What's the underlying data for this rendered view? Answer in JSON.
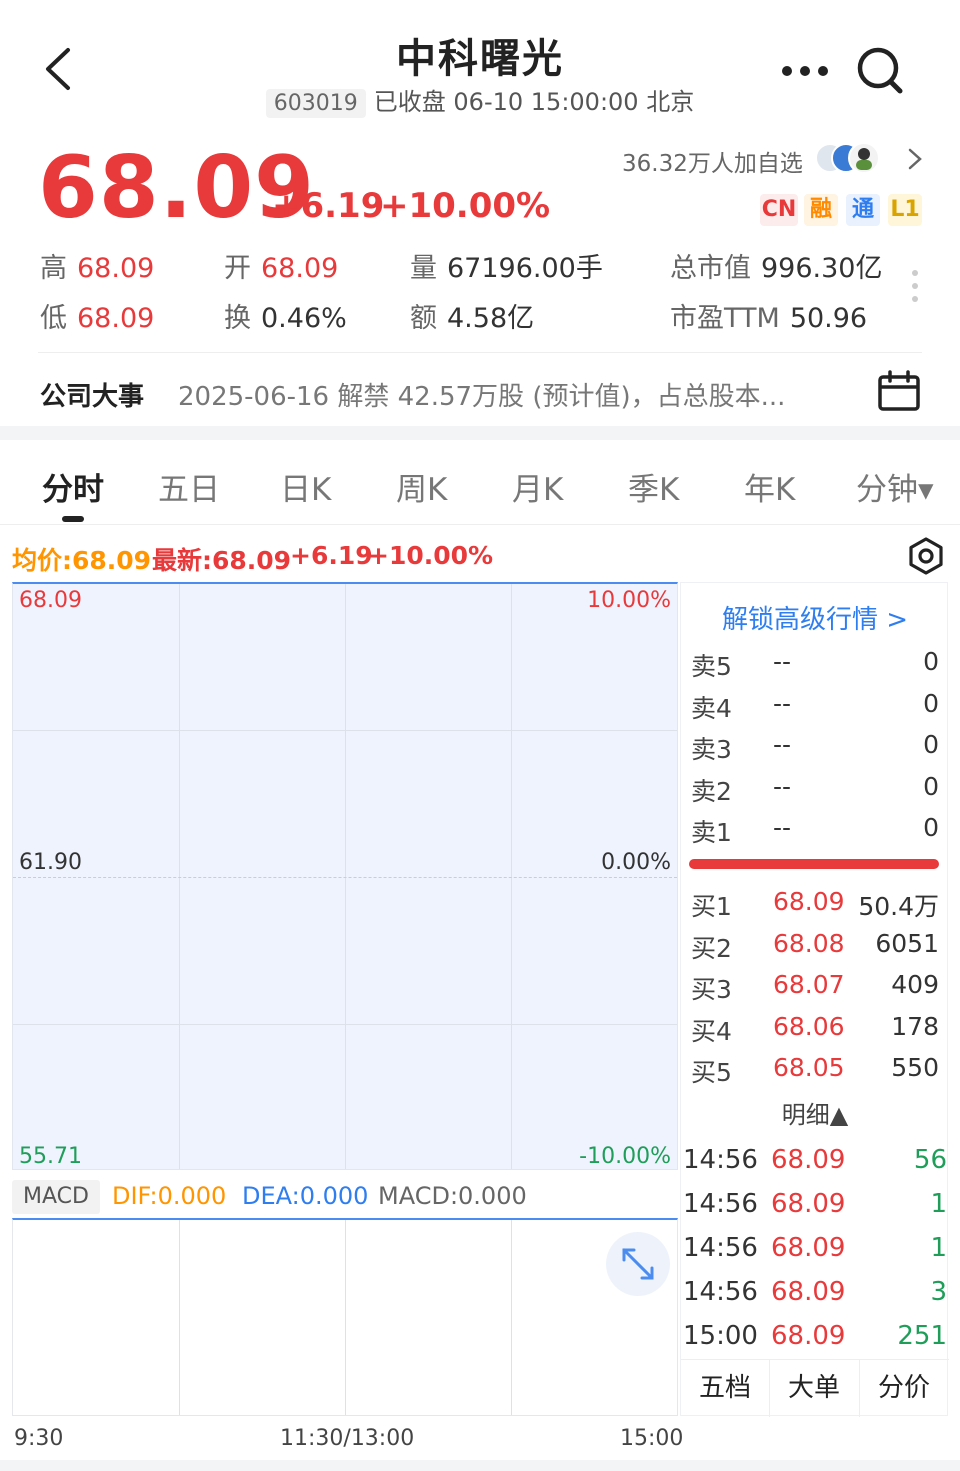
{
  "header": {
    "title": "中科曙光",
    "code": "603019",
    "status": "已收盘 06-10 15:00:00 北京",
    "back_icon": "back-arrow-icon",
    "more_icon": "more-dots-icon",
    "search_icon": "search-icon"
  },
  "quote": {
    "price": "68.09",
    "change": "+6.19",
    "change_pct": "+10.00%",
    "followers": "36.32万人加自选",
    "tags": [
      "CN",
      "融",
      "通",
      "L1"
    ]
  },
  "stats": {
    "high_k": "高",
    "high_v": "68.09",
    "open_k": "开",
    "open_v": "68.09",
    "vol_k": "量",
    "vol_v": "67196.00手",
    "mcap_k": "总市值",
    "mcap_v": "996.30亿",
    "low_k": "低",
    "low_v": "68.09",
    "turn_k": "换",
    "turn_v": "0.46%",
    "amt_k": "额",
    "amt_v": "4.58亿",
    "pe_k": "市盈TTM",
    "pe_v": "50.96"
  },
  "event": {
    "label": "公司大事",
    "text": "2025-06-16 解禁 42.57万股 (预计值)，占总股本..."
  },
  "tabs": [
    "分时",
    "五日",
    "日K",
    "周K",
    "月K",
    "季K",
    "年K",
    "分钟▾"
  ],
  "chart_header": {
    "avg": "均价:68.09",
    "latest": "最新:68.09",
    "change": "+6.19",
    "change_pct": "+10.00%"
  },
  "chart": {
    "y_top": "68.09",
    "y_mid": "61.90",
    "y_bot": "55.71",
    "pct_top": "10.00%",
    "pct_mid": "0.00%",
    "pct_bot": "-10.00%",
    "x_labels": [
      "9:30",
      "11:30/13:00",
      "15:00"
    ]
  },
  "macd": {
    "label": "MACD",
    "dif": "DIF:0.000",
    "dea": "DEA:0.000",
    "macd": "MACD:0.000"
  },
  "orderbook": {
    "unlock": "解锁高级行情 >",
    "asks": [
      {
        "label": "卖5",
        "price": "--",
        "vol": "0"
      },
      {
        "label": "卖4",
        "price": "--",
        "vol": "0"
      },
      {
        "label": "卖3",
        "price": "--",
        "vol": "0"
      },
      {
        "label": "卖2",
        "price": "--",
        "vol": "0"
      },
      {
        "label": "卖1",
        "price": "--",
        "vol": "0"
      }
    ],
    "bids": [
      {
        "label": "买1",
        "price": "68.09",
        "vol": "50.4万"
      },
      {
        "label": "买2",
        "price": "68.08",
        "vol": "6051"
      },
      {
        "label": "买3",
        "price": "68.07",
        "vol": "409"
      },
      {
        "label": "买4",
        "price": "68.06",
        "vol": "178"
      },
      {
        "label": "买5",
        "price": "68.05",
        "vol": "550"
      }
    ],
    "detail_header": "明细▲",
    "ticks": [
      {
        "time": "14:56",
        "price": "68.09",
        "vol": "56"
      },
      {
        "time": "14:56",
        "price": "68.09",
        "vol": "1"
      },
      {
        "time": "14:56",
        "price": "68.09",
        "vol": "1"
      },
      {
        "time": "14:56",
        "price": "68.09",
        "vol": "3"
      },
      {
        "time": "15:00",
        "price": "68.09",
        "vol": "251"
      }
    ],
    "bottom_tabs": [
      "五档",
      "大单",
      "分价"
    ]
  },
  "colors": {
    "up": "#e8393b",
    "down": "#1f9e5a",
    "accent": "#2f7ef0",
    "avg_line": "#ff9500"
  }
}
